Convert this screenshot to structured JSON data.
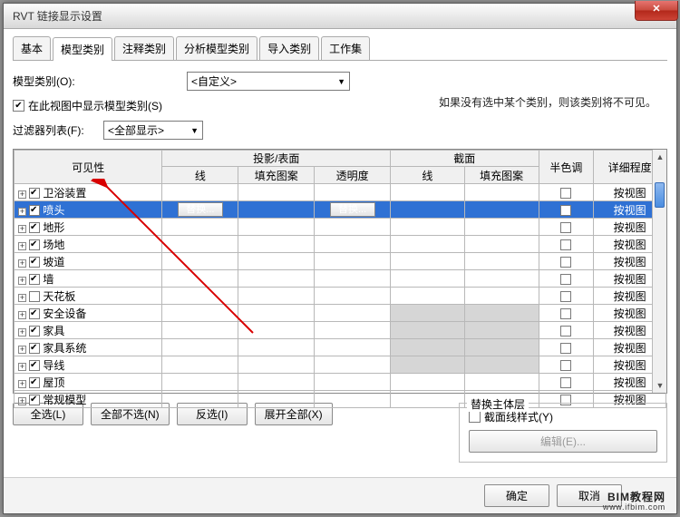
{
  "window": {
    "title": "RVT 链接显示设置",
    "close": "✕"
  },
  "tabs": [
    "基本",
    "模型类别",
    "注释类别",
    "分析模型类别",
    "导入类别",
    "工作集"
  ],
  "active_tab": 1,
  "model_cat": {
    "label": "模型类别(O):",
    "dropdown": "<自定义>",
    "show_in_view": {
      "checked": true,
      "label": "在此视图中显示模型类别(S)"
    },
    "filter_label": "过滤器列表(F):",
    "filter_value": "<全部显示>",
    "note": "如果没有选中某个类别，则该类别将不可见。"
  },
  "columns": {
    "visibility": "可见性",
    "proj_surface": "投影/表面",
    "proj_line": "线",
    "proj_fill": "填充图案",
    "proj_trans": "透明度",
    "section": "截面",
    "sect_line": "线",
    "sect_fill": "填充图案",
    "halftone": "半色调",
    "detail": "详细程度"
  },
  "detail_default": "按视图",
  "replace_btn": "替换...",
  "rows": [
    {
      "name": "卫浴装置",
      "checked": true,
      "selected": false,
      "shadeSect": false
    },
    {
      "name": "喷头",
      "checked": true,
      "selected": true,
      "shadeSect": true
    },
    {
      "name": "地形",
      "checked": true,
      "selected": false,
      "shadeSect": false
    },
    {
      "name": "场地",
      "checked": true,
      "selected": false,
      "shadeSect": false
    },
    {
      "name": "坡道",
      "checked": true,
      "selected": false,
      "shadeSect": false
    },
    {
      "name": "墙",
      "checked": true,
      "selected": false,
      "shadeSect": false
    },
    {
      "name": "天花板",
      "checked": false,
      "selected": false,
      "shadeSect": false
    },
    {
      "name": "安全设备",
      "checked": true,
      "selected": false,
      "shadeSect": true
    },
    {
      "name": "家具",
      "checked": true,
      "selected": false,
      "shadeSect": true
    },
    {
      "name": "家具系统",
      "checked": true,
      "selected": false,
      "shadeSect": true
    },
    {
      "name": "导线",
      "checked": true,
      "selected": false,
      "shadeSect": true
    },
    {
      "name": "屋顶",
      "checked": true,
      "selected": false,
      "shadeSect": false
    },
    {
      "name": "常规模型",
      "checked": true,
      "selected": false,
      "shadeSect": false
    }
  ],
  "bottom": {
    "select_all": "全选(L)",
    "select_none": "全部不选(N)",
    "invert": "反选(I)",
    "expand_all": "展开全部(X)",
    "host_layer": {
      "legend": "替换主体层",
      "cut_style": "截面线样式(Y)",
      "edit": "编辑(E)..."
    }
  },
  "footer": {
    "ok": "确定",
    "cancel": "取消"
  },
  "watermark": {
    "big": "BIM教程网",
    "small": "www.ifbim.com"
  }
}
